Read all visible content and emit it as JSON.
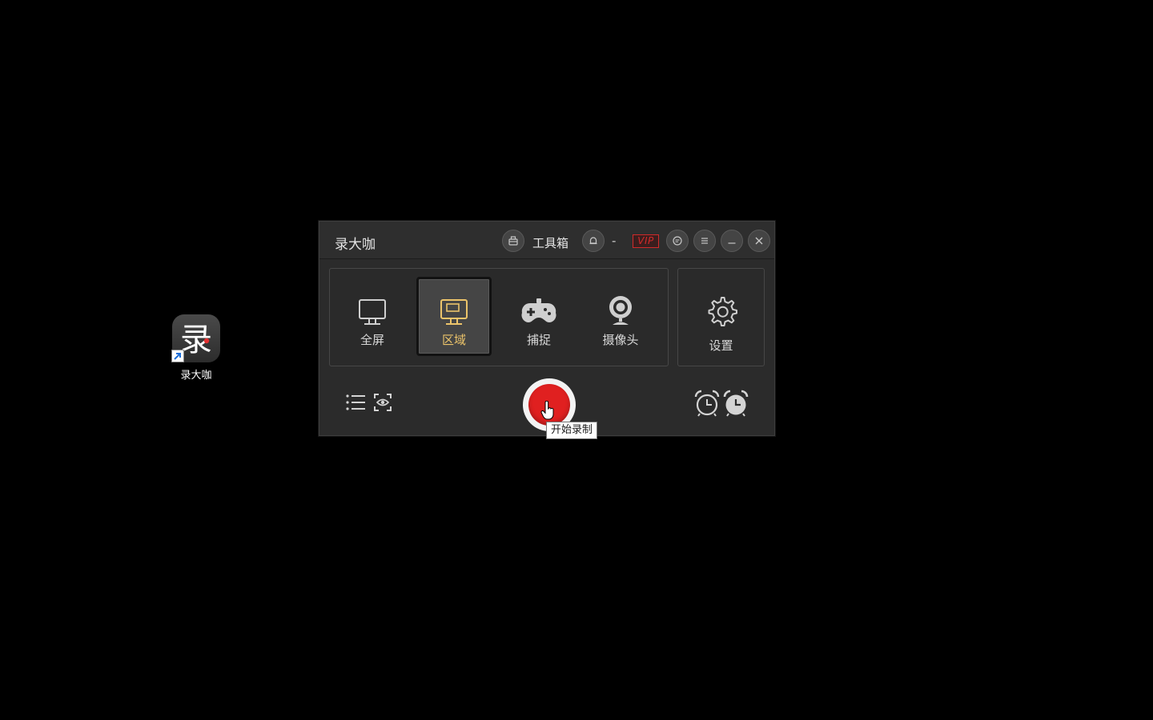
{
  "desktop": {
    "shortcut_label": "录大咖",
    "shortcut_glyph": "录",
    "icon": "app-shortcut-icon"
  },
  "window": {
    "title": "录大咖",
    "toolbox_label": "工具箱",
    "user_status": "-",
    "vip_label": "VIP",
    "titlebar_icons": [
      "toolbox-icon",
      "user-bell-icon",
      "message-icon",
      "menu-icon",
      "minimize-icon",
      "close-icon"
    ]
  },
  "modes": [
    {
      "label": "全屏",
      "icon": "monitor-icon",
      "active": false
    },
    {
      "label": "区域",
      "icon": "region-monitor-icon",
      "active": true
    },
    {
      "label": "捕捉",
      "icon": "gamepad-icon",
      "active": false
    },
    {
      "label": "摄像头",
      "icon": "webcam-icon",
      "active": false
    }
  ],
  "settings": {
    "label": "设置",
    "icon": "gear-icon"
  },
  "bottom": {
    "left_icons": [
      "list-icon",
      "preview-eye-icon"
    ],
    "right_icons": [
      "timer-alarm-icon",
      "scheduled-alarm-icon"
    ],
    "record_tooltip": "开始录制"
  },
  "colors": {
    "accent_active": "#ecc46a",
    "record_red": "#e02020",
    "vip_red": "#d12a2a",
    "window_bg": "#2b2b2b"
  }
}
